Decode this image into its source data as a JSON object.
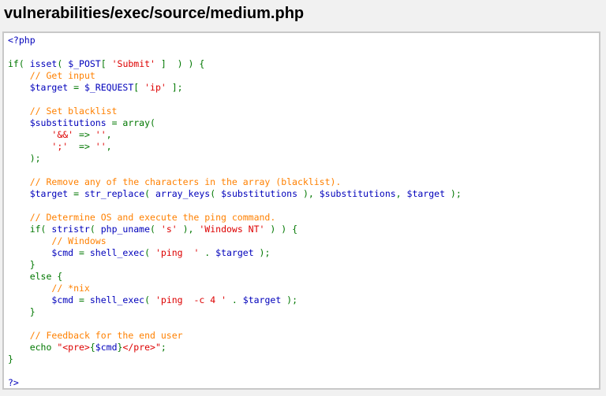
{
  "page": {
    "title": "vulnerabilities/exec/source/medium.php"
  },
  "colors": {
    "background": "#f1f1f1",
    "code_background": "#ffffff",
    "code_border": "#c8c8c8",
    "default": "#0000bb",
    "keyword": "#007700",
    "string": "#dd0000",
    "comment": "#ff8000"
  },
  "code": {
    "lines": [
      [
        [
          "default",
          "<?php"
        ]
      ],
      [],
      [
        [
          "keyword",
          "if( "
        ],
        [
          "default",
          "isset"
        ],
        [
          "keyword",
          "( "
        ],
        [
          "default",
          "$_POST"
        ],
        [
          "keyword",
          "[ "
        ],
        [
          "string",
          "'Submit'"
        ],
        [
          "keyword",
          " ]  ) ) {"
        ]
      ],
      [
        [
          "keyword",
          "    "
        ],
        [
          "comment",
          "// Get input"
        ]
      ],
      [
        [
          "keyword",
          "    "
        ],
        [
          "default",
          "$target "
        ],
        [
          "keyword",
          "= "
        ],
        [
          "default",
          "$_REQUEST"
        ],
        [
          "keyword",
          "[ "
        ],
        [
          "string",
          "'ip'"
        ],
        [
          "keyword",
          " ];"
        ]
      ],
      [],
      [
        [
          "keyword",
          "    "
        ],
        [
          "comment",
          "// Set blacklist"
        ]
      ],
      [
        [
          "keyword",
          "    "
        ],
        [
          "default",
          "$substitutions "
        ],
        [
          "keyword",
          "= array("
        ]
      ],
      [
        [
          "keyword",
          "        "
        ],
        [
          "string",
          "'&&'"
        ],
        [
          "keyword",
          " => "
        ],
        [
          "string",
          "''"
        ],
        [
          "keyword",
          ","
        ]
      ],
      [
        [
          "keyword",
          "        "
        ],
        [
          "string",
          "';'"
        ],
        [
          "keyword",
          "  => "
        ],
        [
          "string",
          "''"
        ],
        [
          "keyword",
          ","
        ]
      ],
      [
        [
          "keyword",
          "    );"
        ]
      ],
      [],
      [
        [
          "keyword",
          "    "
        ],
        [
          "comment",
          "// Remove any of the characters in the array (blacklist)."
        ]
      ],
      [
        [
          "keyword",
          "    "
        ],
        [
          "default",
          "$target "
        ],
        [
          "keyword",
          "= "
        ],
        [
          "default",
          "str_replace"
        ],
        [
          "keyword",
          "( "
        ],
        [
          "default",
          "array_keys"
        ],
        [
          "keyword",
          "( "
        ],
        [
          "default",
          "$substitutions "
        ],
        [
          "keyword",
          "), "
        ],
        [
          "default",
          "$substitutions"
        ],
        [
          "keyword",
          ", "
        ],
        [
          "default",
          "$target "
        ],
        [
          "keyword",
          ");"
        ]
      ],
      [],
      [
        [
          "keyword",
          "    "
        ],
        [
          "comment",
          "// Determine OS and execute the ping command."
        ]
      ],
      [
        [
          "keyword",
          "    if( "
        ],
        [
          "default",
          "stristr"
        ],
        [
          "keyword",
          "( "
        ],
        [
          "default",
          "php_uname"
        ],
        [
          "keyword",
          "( "
        ],
        [
          "string",
          "'s'"
        ],
        [
          "keyword",
          " ), "
        ],
        [
          "string",
          "'Windows NT'"
        ],
        [
          "keyword",
          " ) ) {"
        ]
      ],
      [
        [
          "keyword",
          "        "
        ],
        [
          "comment",
          "// Windows"
        ]
      ],
      [
        [
          "keyword",
          "        "
        ],
        [
          "default",
          "$cmd "
        ],
        [
          "keyword",
          "= "
        ],
        [
          "default",
          "shell_exec"
        ],
        [
          "keyword",
          "( "
        ],
        [
          "string",
          "'ping  '"
        ],
        [
          "keyword",
          " . "
        ],
        [
          "default",
          "$target "
        ],
        [
          "keyword",
          ");"
        ]
      ],
      [
        [
          "keyword",
          "    }"
        ]
      ],
      [
        [
          "keyword",
          "    else {"
        ]
      ],
      [
        [
          "keyword",
          "        "
        ],
        [
          "comment",
          "// *nix"
        ]
      ],
      [
        [
          "keyword",
          "        "
        ],
        [
          "default",
          "$cmd "
        ],
        [
          "keyword",
          "= "
        ],
        [
          "default",
          "shell_exec"
        ],
        [
          "keyword",
          "( "
        ],
        [
          "string",
          "'ping  -c 4 '"
        ],
        [
          "keyword",
          " . "
        ],
        [
          "default",
          "$target "
        ],
        [
          "keyword",
          ");"
        ]
      ],
      [
        [
          "keyword",
          "    }"
        ]
      ],
      [],
      [
        [
          "keyword",
          "    "
        ],
        [
          "comment",
          "// Feedback for the end user"
        ]
      ],
      [
        [
          "keyword",
          "    echo "
        ],
        [
          "string",
          "\"<pre>"
        ],
        [
          "keyword",
          "{"
        ],
        [
          "default",
          "$cmd"
        ],
        [
          "keyword",
          "}"
        ],
        [
          "string",
          "</pre>\""
        ],
        [
          "keyword",
          ";"
        ]
      ],
      [
        [
          "keyword",
          "}"
        ]
      ],
      [],
      [
        [
          "default",
          "?>"
        ]
      ]
    ]
  }
}
